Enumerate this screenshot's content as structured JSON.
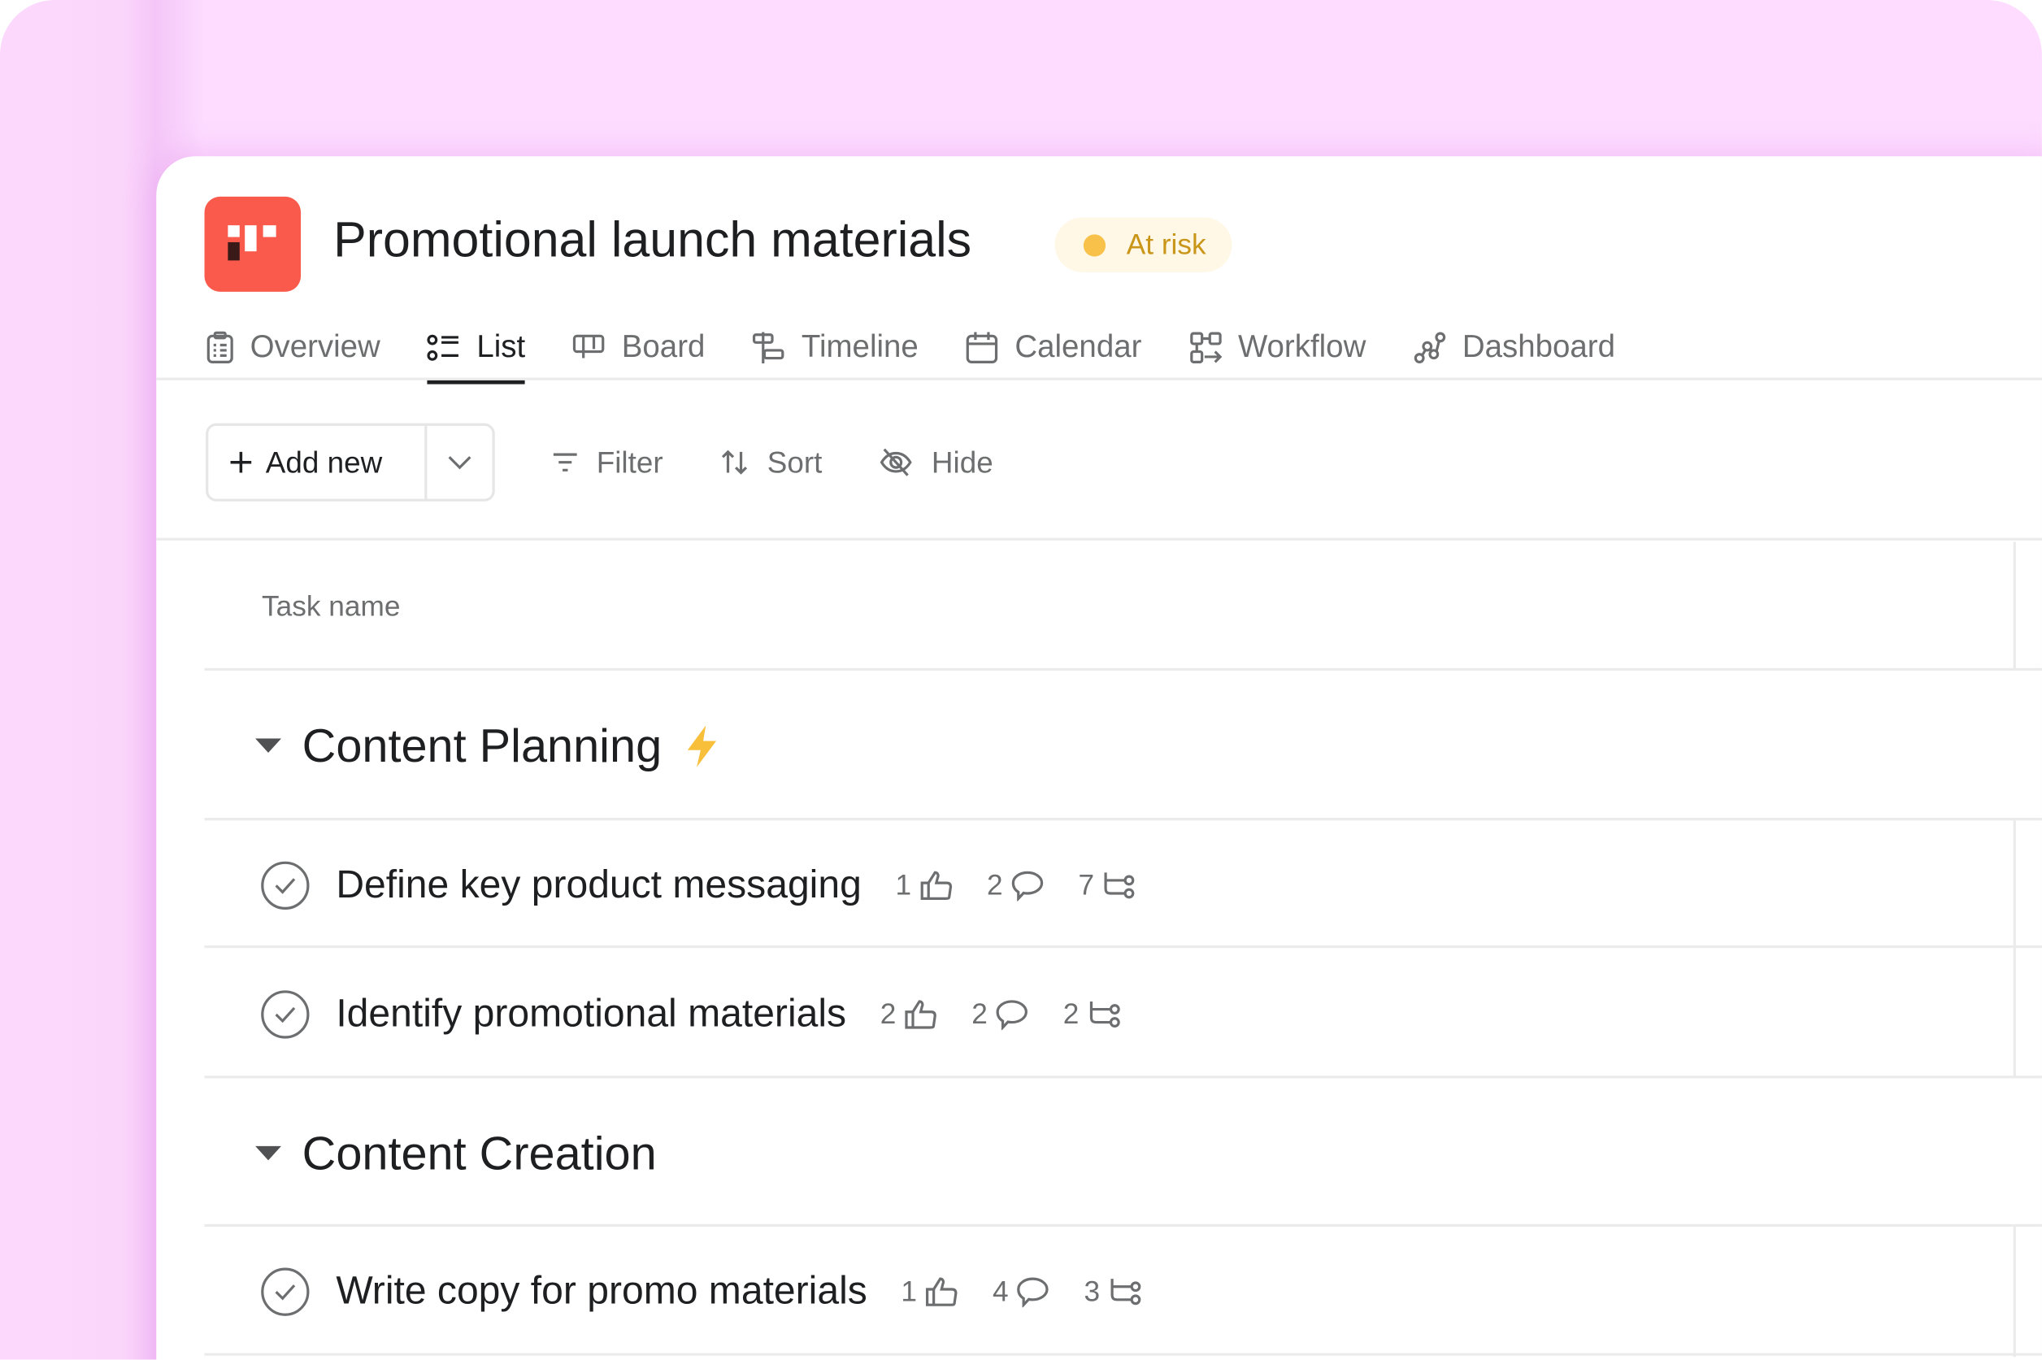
{
  "project": {
    "title": "Promotional launch materials",
    "status": "At risk",
    "status_color": "#f8c24a",
    "logo_color": "#f95a4b"
  },
  "tabs": [
    {
      "label": "Overview",
      "icon": "clipboard-icon"
    },
    {
      "label": "List",
      "icon": "list-icon",
      "active": true
    },
    {
      "label": "Board",
      "icon": "board-icon"
    },
    {
      "label": "Timeline",
      "icon": "timeline-icon"
    },
    {
      "label": "Calendar",
      "icon": "calendar-icon"
    },
    {
      "label": "Workflow",
      "icon": "workflow-icon"
    },
    {
      "label": "Dashboard",
      "icon": "dashboard-icon"
    }
  ],
  "toolbar": {
    "add_new": "Add new",
    "filter": "Filter",
    "sort": "Sort",
    "hide": "Hide"
  },
  "table": {
    "task_name_header": "Task name"
  },
  "sections": [
    {
      "title": "Content Planning",
      "emoji": "⚡",
      "tasks": [
        {
          "name": "Define key product messaging",
          "likes": "1",
          "comments": "2",
          "subtasks": "7"
        },
        {
          "name": "Identify promotional materials",
          "likes": "2",
          "comments": "2",
          "subtasks": "2"
        }
      ]
    },
    {
      "title": "Content Creation",
      "tasks": [
        {
          "name": "Write copy for promo materials",
          "likes": "1",
          "comments": "4",
          "subtasks": "3"
        }
      ]
    }
  ]
}
